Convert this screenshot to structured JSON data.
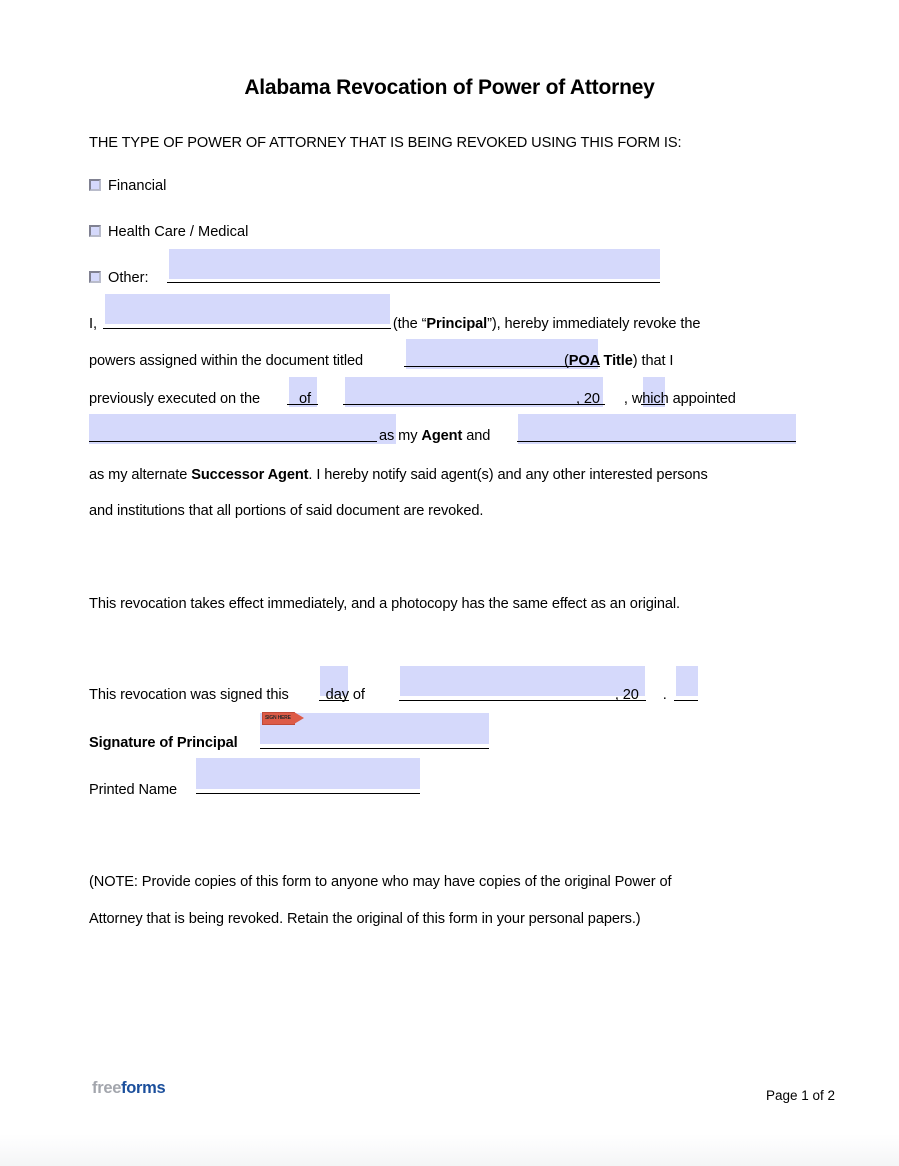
{
  "document": {
    "title": "Alabama Revocation of Power of Attorney",
    "intro_heading": "THE TYPE OF POWER OF ATTORNEY THAT IS BEING REVOKED USING THIS FORM IS:"
  },
  "checkboxes": [
    {
      "id": "financial",
      "label": "Financial"
    },
    {
      "id": "health-care-medical",
      "label": "Health Care / Medical"
    },
    {
      "id": "other",
      "label": "Other:"
    }
  ],
  "body": {
    "line1_pre": "I,",
    "line1_post_a": "(the “",
    "line1_post_b": "Principal",
    "line1_post_c": "”), hereby immediately revoke the",
    "line2_pre": "powers assigned within the document titled",
    "line2_post_a": "(",
    "line2_post_b": "POA Title",
    "line2_post_c": ") that I",
    "line3_pre": "previously executed on the",
    "line3_mid": "of",
    "line3_year": ", 20",
    "line3_post": ", which appointed",
    "line4_mid_a": "as my ",
    "line4_mid_b": "Agent",
    "line4_mid_c": " and",
    "line5_a": "as my alternate ",
    "line5_b": "Successor Agent",
    "line5_c": ". I hereby notify said agent(s) and any other interested persons",
    "line6": "and institutions that all portions of said document are revoked.",
    "effect_paragraph": "This revocation takes effect immediately, and a photocopy has the same effect as an original."
  },
  "signing": {
    "signed_pre": "This revocation was signed this",
    "signed_day": "day of",
    "signed_year": ", 20",
    "signed_period": ".",
    "signature_label": "Signature of Principal",
    "printed_name_label": "Printed Name",
    "sign_tag_text": "SIGN HERE"
  },
  "note": {
    "line1": "(NOTE: Provide copies of this form to anyone who may have copies of the original Power of",
    "line2": "Attorney that is being revoked. Retain the original of this form in your personal papers.)"
  },
  "footer": {
    "logo_free": "free",
    "logo_forms": "forms",
    "page_label": "Page 1 of 2"
  },
  "colors": {
    "field_fill": "#d5d9fb",
    "logo_blue": "#1b4f9c",
    "logo_gray": "#a3a6ad",
    "sign_tag_red": "#dd5b47"
  }
}
